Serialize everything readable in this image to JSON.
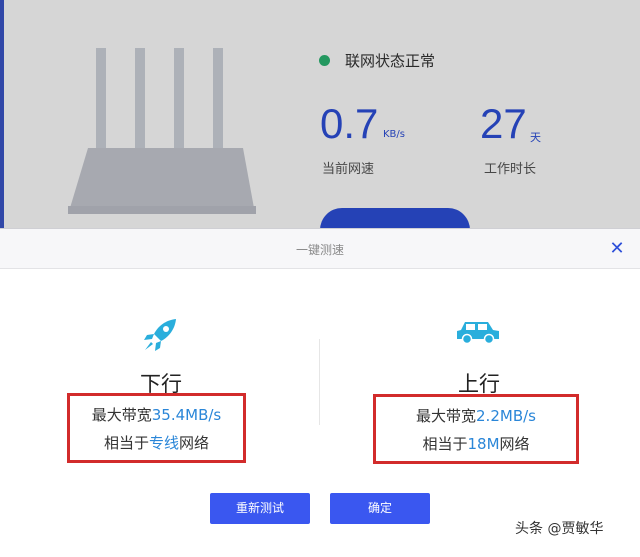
{
  "dashboard": {
    "status_text": "联网状态正常",
    "speed_value": "0.7",
    "speed_unit": "KB/s",
    "speed_label": "当前网速",
    "uptime_value": "27",
    "uptime_unit": "天",
    "uptime_label": "工作时长"
  },
  "modal": {
    "title": "一键测速",
    "close_symbol": "✕",
    "download": {
      "title": "下行",
      "max_bandwidth_prefix": "最大带宽",
      "max_bandwidth_value": "35.4MB/s",
      "equivalent_prefix": "相当于",
      "equivalent_value": "专线",
      "equivalent_suffix": "网络"
    },
    "upload": {
      "title": "上行",
      "max_bandwidth_prefix": "最大带宽",
      "max_bandwidth_value": "2.2MB/s",
      "equivalent_prefix": "相当于",
      "equivalent_value": "18M",
      "equivalent_suffix": "网络"
    },
    "retest_label": "重新测试",
    "confirm_label": "确定"
  },
  "watermark": "头条 @贾敏华",
  "colors": {
    "accent": "#3a57f0",
    "highlight": "#2a86d8",
    "annotation": "#d22b2b",
    "status_ok": "#2bb673"
  },
  "icons": {
    "download": "rocket-icon",
    "upload": "car-icon",
    "close": "close-icon"
  }
}
